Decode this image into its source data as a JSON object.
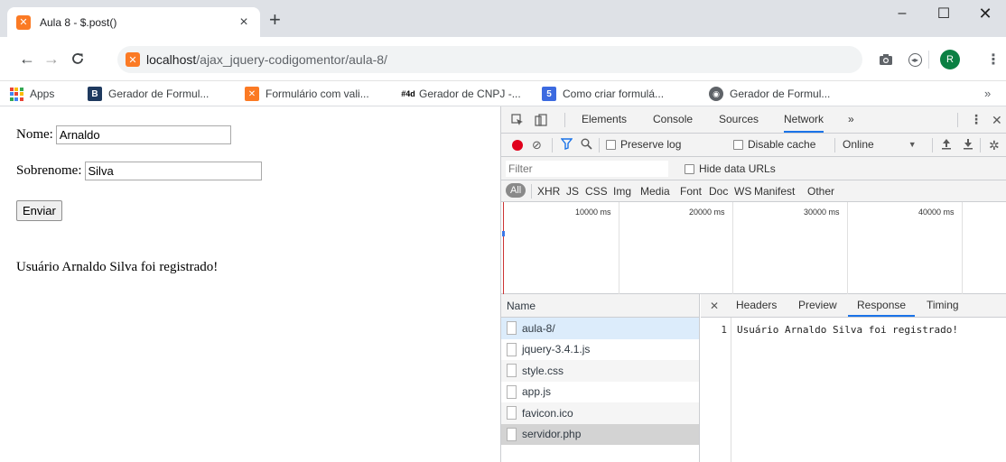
{
  "tab": {
    "title": "Aula 8 - $.post()",
    "favicon": "xampp-icon",
    "close": "×",
    "new_tab": "+"
  },
  "window": {
    "minimize": "–",
    "maximize": "☐",
    "close": "✕"
  },
  "toolbar": {
    "back": "←",
    "forward": "→",
    "reload": "C",
    "url_host": "localhost",
    "url_path": "/ajax_jquery-codigomentor/aula-8/",
    "avatar_letter": "R",
    "menu": "⋮"
  },
  "bookmarks": {
    "items": [
      {
        "label": "Apps",
        "icon": "apps-grid-icon"
      },
      {
        "label": "Gerador de Formul...",
        "icon": "b-icon",
        "badge": "B",
        "color": "#1f3a5f"
      },
      {
        "label": "Formulário com vali...",
        "icon": "xampp-icon",
        "badge": "✕",
        "color": "#fb7a24"
      },
      {
        "label": "Gerador de CNPJ -...",
        "icon": "4devs-icon",
        "badge": "#4d",
        "color": "#000000"
      },
      {
        "label": "Como criar formulá...",
        "icon": "html5-icon",
        "badge": "5",
        "color": "#3c6ae0"
      },
      {
        "label": "Gerador de Formul...",
        "icon": "globe-icon",
        "badge": "◉",
        "color": "#5f6368"
      }
    ],
    "more": "»"
  },
  "page": {
    "nome_label": "Nome:",
    "nome_value": "Arnaldo",
    "sobrenome_label": "Sobrenome:",
    "sobrenome_value": "Silva",
    "submit_label": "Enviar",
    "result": "Usuário Arnaldo Silva foi registrado!"
  },
  "devtools": {
    "tabs": [
      "Elements",
      "Console",
      "Sources",
      "Network"
    ],
    "active_tab": "Network",
    "more_tabs": "»",
    "preserve_log": "Preserve log",
    "disable_cache": "Disable cache",
    "throttle": "Online",
    "filter_placeholder": "Filter",
    "hide_data_urls": "Hide data URLs",
    "types": [
      "All",
      "XHR",
      "JS",
      "CSS",
      "Img",
      "Media",
      "Font",
      "Doc",
      "WS",
      "Manifest",
      "Other"
    ],
    "timeline_labels": [
      "10000 ms",
      "20000 ms",
      "30000 ms",
      "40000 ms"
    ],
    "name_header": "Name",
    "requests": [
      "aula-8/",
      "jquery-3.4.1.js",
      "style.css",
      "app.js",
      "favicon.ico",
      "servidor.php"
    ],
    "detail_tabs": [
      "Headers",
      "Preview",
      "Response",
      "Timing"
    ],
    "active_detail": "Response",
    "response_line_no": "1",
    "response_text": "Usuário Arnaldo Silva foi registrado!",
    "colors": {
      "accent": "#1a73e8",
      "record": "#e0001b",
      "selected_row": "#dcecfb"
    }
  }
}
